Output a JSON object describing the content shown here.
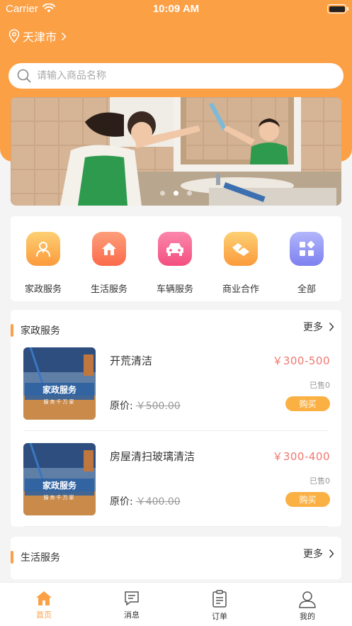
{
  "status_bar": {
    "carrier": "Carrier",
    "time": "10:09 AM"
  },
  "location": {
    "city": "天津市"
  },
  "search": {
    "placeholder": "请输入商品名称"
  },
  "banner": {
    "page_count": 3,
    "active_page": 2
  },
  "categories": [
    {
      "label": "家政服务",
      "icon": "housekeeping-icon",
      "color": "#fbb044"
    },
    {
      "label": "生活服务",
      "icon": "home-icon",
      "color": "#fb7b5b"
    },
    {
      "label": "车辆服务",
      "icon": "car-icon",
      "color": "#f5588a"
    },
    {
      "label": "商业合作",
      "icon": "handshake-icon",
      "color": "#fbb044"
    },
    {
      "label": "全部",
      "icon": "all-grid-icon",
      "color": "#8f8ff5"
    }
  ],
  "sections": [
    {
      "title": "家政服务",
      "more": "更多",
      "products": [
        {
          "name": "开荒清洁",
          "price": "￥300-500",
          "sold": "已售0",
          "orig_label": "原价:",
          "orig_price": "￥500.00",
          "buy": "购买",
          "thumb_text": "家政服务",
          "thumb_sub": "服务千万家"
        },
        {
          "name": "房屋清扫玻璃清洁",
          "price": "￥300-400",
          "sold": "已售0",
          "orig_label": "原价:",
          "orig_price": "￥400.00",
          "buy": "购买",
          "thumb_text": "家政服务",
          "thumb_sub": "服务千万家"
        }
      ]
    },
    {
      "title": "生活服务",
      "more": "更多"
    }
  ],
  "tabbar": [
    {
      "label": "首页",
      "icon": "home-tab-icon",
      "active": true
    },
    {
      "label": "消息",
      "icon": "message-icon"
    },
    {
      "label": "订单",
      "icon": "order-clipboard-icon"
    },
    {
      "label": "我的",
      "icon": "user-icon"
    }
  ],
  "colors": {
    "primary": "#fca046",
    "price": "#f0776f",
    "buy": "#fbb044"
  }
}
